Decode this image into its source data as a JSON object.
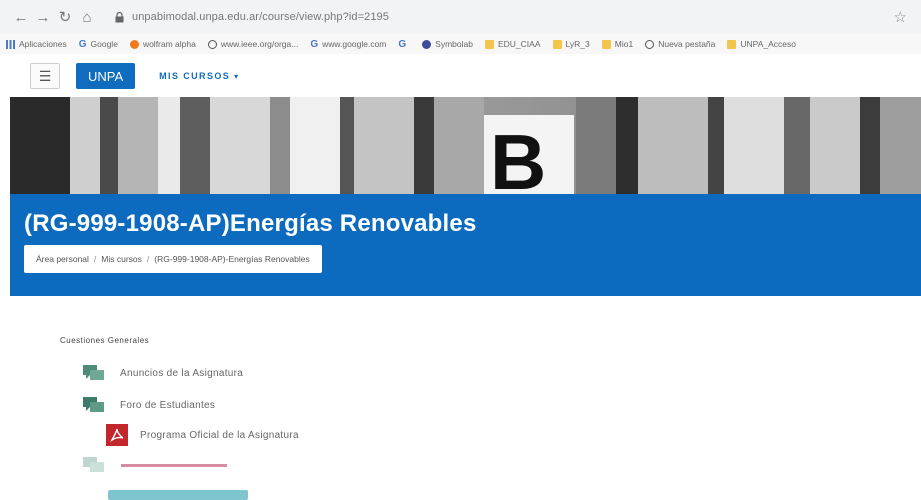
{
  "browser": {
    "url": "unpabimodal.unpa.edu.ar/course/view.php?id=2195",
    "bookmarks": [
      {
        "label": "Aplicaciones",
        "icon": "apps-grid-icon"
      },
      {
        "label": "Google",
        "icon": "google-icon"
      },
      {
        "label": "wolfram alpha",
        "icon": "wolfram-icon"
      },
      {
        "label": "www.ieee.org/orga...",
        "icon": "globe-icon"
      },
      {
        "label": "www.google.com",
        "icon": "google-icon"
      },
      {
        "label": "",
        "icon": "google-icon"
      },
      {
        "label": "Symbolab",
        "icon": "symbolab-icon"
      },
      {
        "label": "EDU_CIAA",
        "icon": "folder-icon"
      },
      {
        "label": "LyR_3",
        "icon": "folder-icon"
      },
      {
        "label": "Mio1",
        "icon": "folder-icon"
      },
      {
        "label": "Nueva pestaña",
        "icon": "globe-icon"
      },
      {
        "label": "UNPA_Acceso",
        "icon": "folder-icon"
      }
    ]
  },
  "navbar": {
    "brand": "UNPA",
    "my_courses": "MIS CURSOS"
  },
  "header": {
    "image_letter": "B"
  },
  "course": {
    "title": "(RG-999-1908-AP)Energías Renovables",
    "breadcrumb": [
      "Área personal",
      "Mis cursos",
      "(RG-999-1908-AP)-Energías Renovables"
    ]
  },
  "section": {
    "title": "Cuestiones Generales",
    "activities": [
      {
        "label": "Anuncios de la Asignatura",
        "icon": "forum-icon"
      },
      {
        "label": "Foro de Estudiantes",
        "icon": "forum-icon"
      },
      {
        "label": "Programa Oficial de la Asignatura",
        "icon": "pdf-icon"
      }
    ]
  },
  "colors": {
    "moodle_blue": "#0d6bbf",
    "pdf_red": "#c1272d",
    "forum_green": "#4f8a7a"
  }
}
